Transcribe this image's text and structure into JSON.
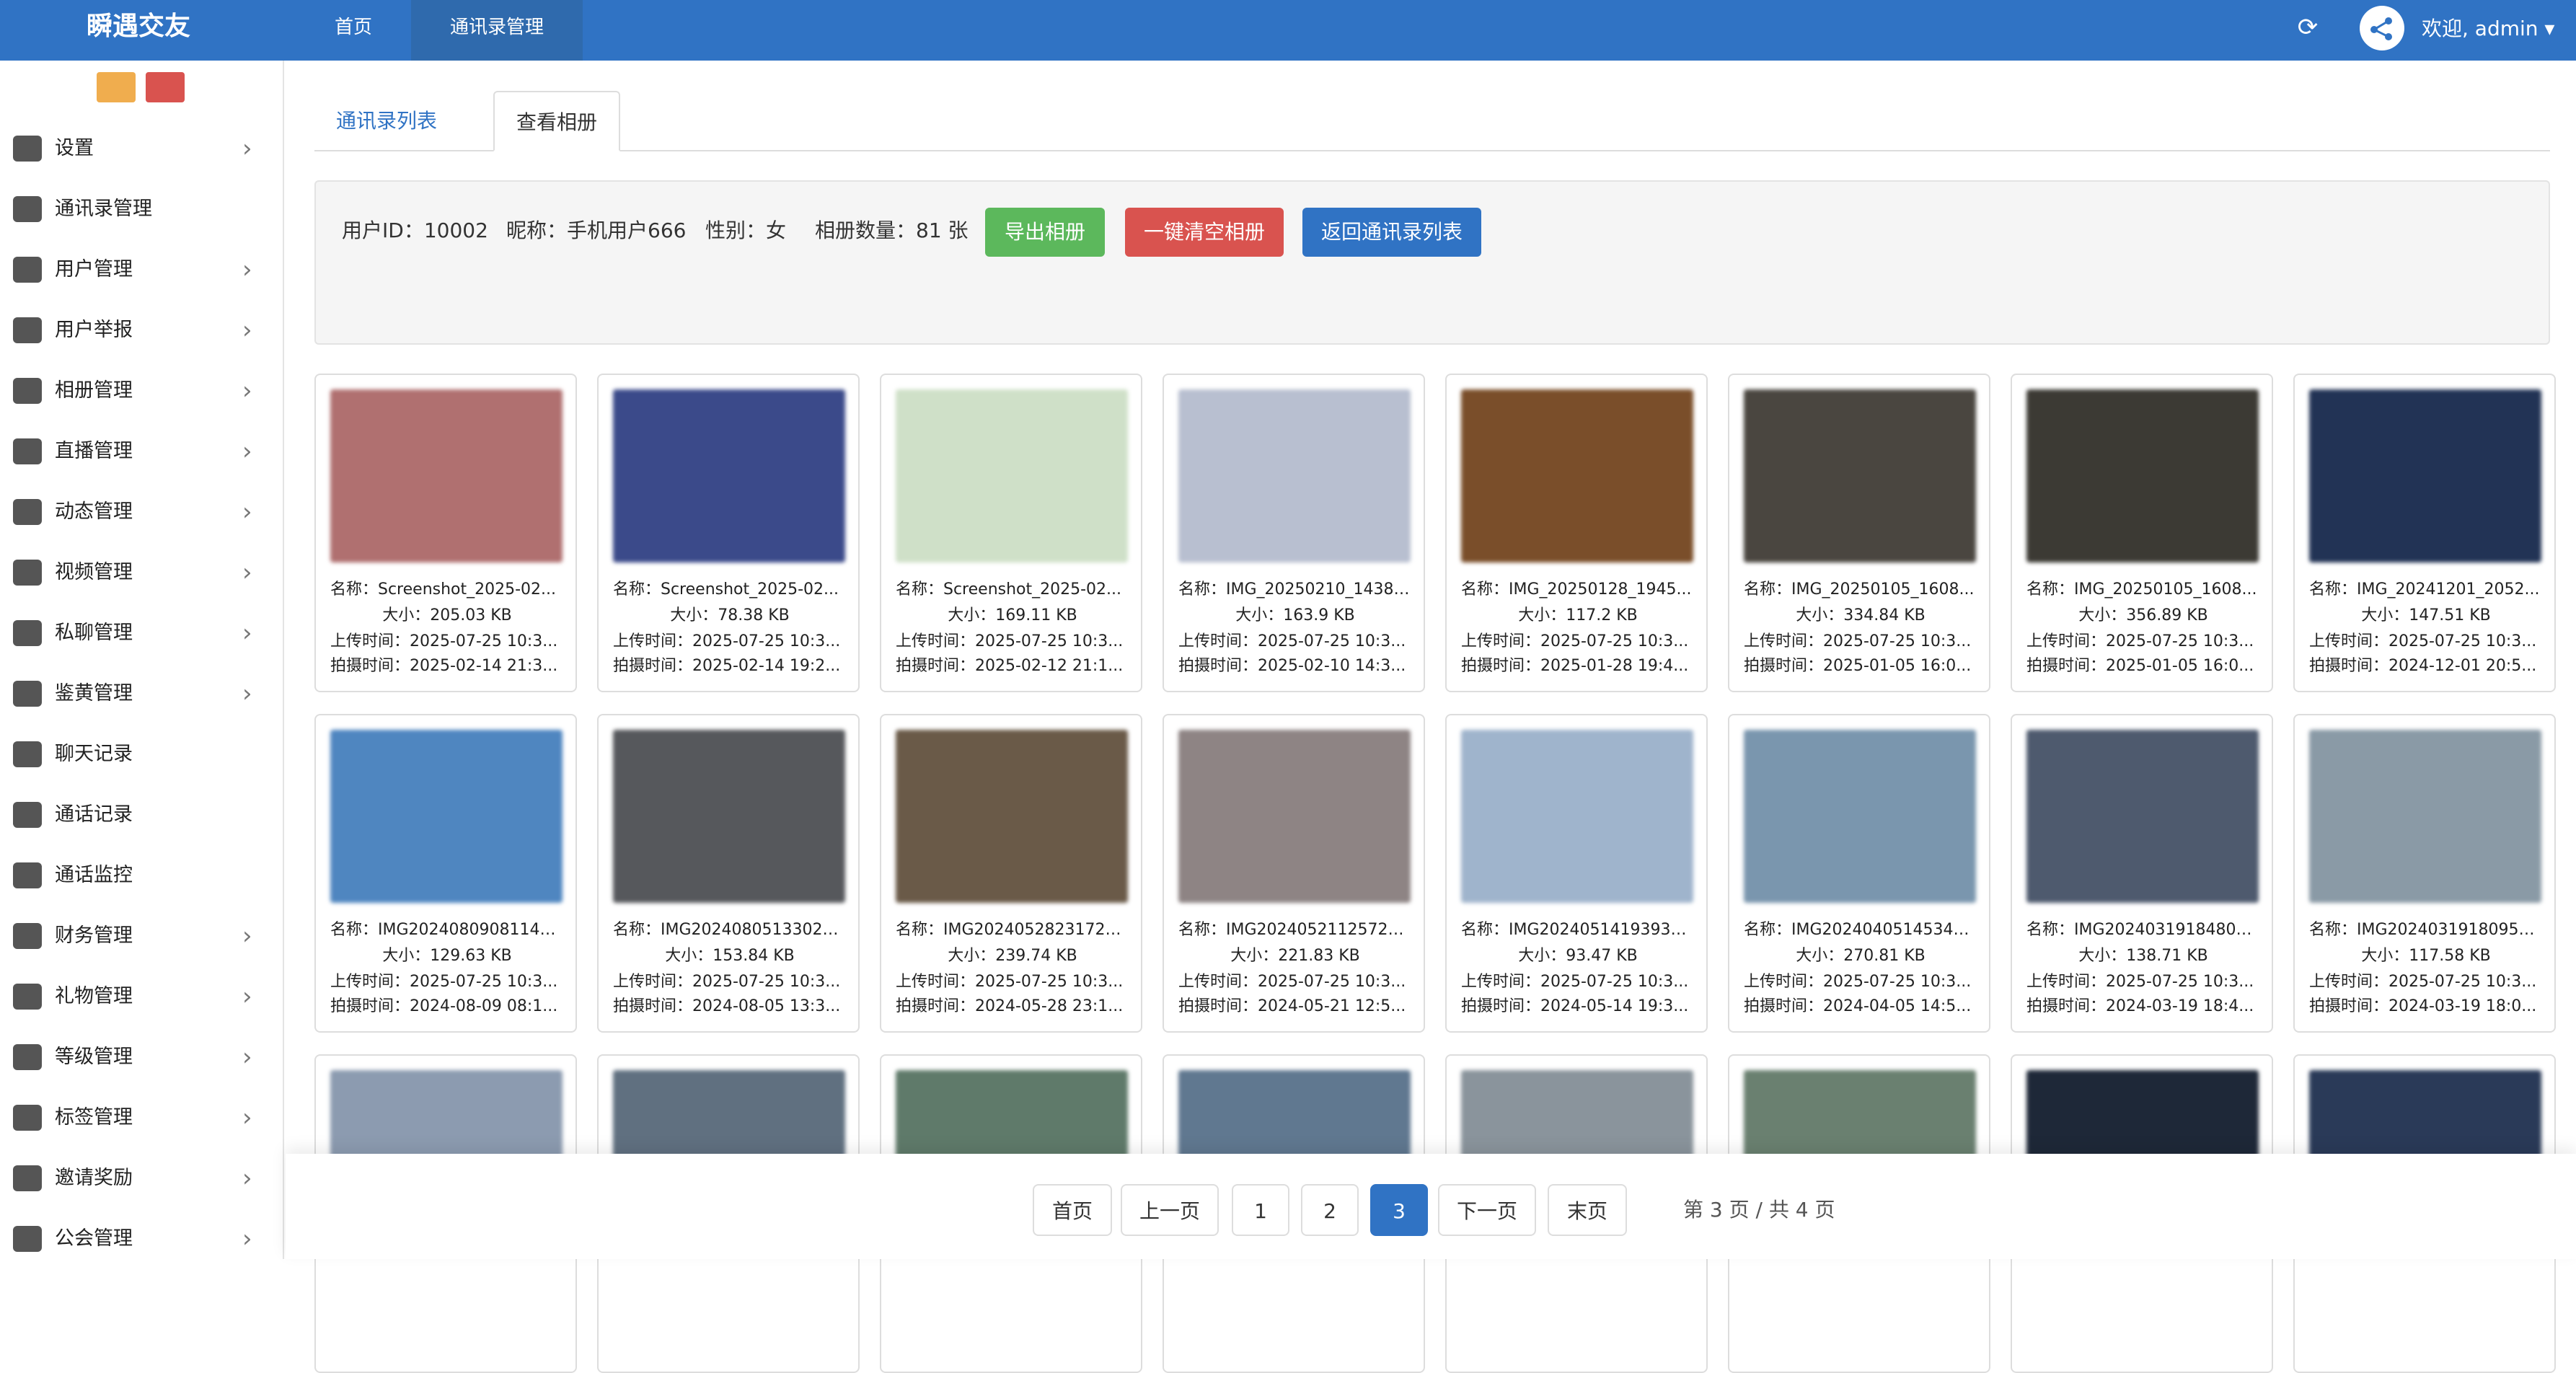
{
  "app": {
    "title": "瞬遇交友"
  },
  "topnav": [
    {
      "label": "首页"
    },
    {
      "label": "通讯录管理"
    }
  ],
  "user": {
    "welcome": "欢迎, admin ▾"
  },
  "sidebar": {
    "items": [
      {
        "label": "设置",
        "icon": "gear-icon",
        "chevron": true
      },
      {
        "label": "通讯录管理",
        "icon": "contacts-icon",
        "chevron": false
      },
      {
        "label": "用户管理",
        "icon": "users-icon",
        "chevron": true
      },
      {
        "label": "用户举报",
        "icon": "report-icon",
        "chevron": true
      },
      {
        "label": "相册管理",
        "icon": "image-icon",
        "chevron": true
      },
      {
        "label": "直播管理",
        "icon": "eye-icon",
        "chevron": true
      },
      {
        "label": "动态管理",
        "icon": "star-icon",
        "chevron": true
      },
      {
        "label": "视频管理",
        "icon": "video-icon",
        "chevron": true
      },
      {
        "label": "私聊管理",
        "icon": "send-icon",
        "chevron": true
      },
      {
        "label": "鉴黄管理",
        "icon": "monitor-icon",
        "chevron": true
      },
      {
        "label": "聊天记录",
        "icon": "chat-icon",
        "chevron": false
      },
      {
        "label": "通话记录",
        "icon": "monitor-icon",
        "chevron": false
      },
      {
        "label": "通话监控",
        "icon": "monitor-icon",
        "chevron": false
      },
      {
        "label": "财务管理",
        "icon": "yen-icon",
        "chevron": true
      },
      {
        "label": "礼物管理",
        "icon": "gift-icon",
        "chevron": true
      },
      {
        "label": "等级管理",
        "icon": "level-icon",
        "chevron": true
      },
      {
        "label": "标签管理",
        "icon": "bookmark-icon",
        "chevron": true
      },
      {
        "label": "邀请奖励",
        "icon": "sitemap-icon",
        "chevron": true
      },
      {
        "label": "公会管理",
        "icon": "monitor-icon",
        "chevron": true
      }
    ]
  },
  "tabs": [
    {
      "label": "通讯录列表"
    },
    {
      "label": "查看相册"
    }
  ],
  "info": {
    "user_id": "用户ID：10002",
    "nickname": "昵称：手机用户666",
    "gender": "性别：女",
    "count": "相册数量：81 张"
  },
  "actions": {
    "export": "导出相册",
    "clear": "一键清空相册",
    "back": "返回通讯录列表"
  },
  "photos": [
    {
      "name": "名称：Screenshot_2025-02...",
      "size": "大小：205.03 KB",
      "upload": "上传时间：2025-07-25 10:3...",
      "shot": "拍摄时间：2025-02-14 21:3...",
      "color": "#b07070"
    },
    {
      "name": "名称：Screenshot_2025-02...",
      "size": "大小：78.38 KB",
      "upload": "上传时间：2025-07-25 10:3...",
      "shot": "拍摄时间：2025-02-14 19:2...",
      "color": "#3b4a8a"
    },
    {
      "name": "名称：Screenshot_2025-02...",
      "size": "大小：169.11 KB",
      "upload": "上传时间：2025-07-25 10:3...",
      "shot": "拍摄时间：2025-02-12 21:1...",
      "color": "#cfe0c8"
    },
    {
      "name": "名称：IMG_20250210_14381...",
      "size": "大小：163.9 KB",
      "upload": "上传时间：2025-07-25 10:3...",
      "shot": "拍摄时间：2025-02-10 14:3...",
      "color": "#b8bfd0"
    },
    {
      "name": "名称：IMG_20250128_1945...",
      "size": "大小：117.2 KB",
      "upload": "上传时间：2025-07-25 10:3...",
      "shot": "拍摄时间：2025-01-28 19:4...",
      "color": "#7a4e2a"
    },
    {
      "name": "名称：IMG_20250105_1608...",
      "size": "大小：334.84 KB",
      "upload": "上传时间：2025-07-25 10:3...",
      "shot": "拍摄时间：2025-01-05 16:0...",
      "color": "#4a4640"
    },
    {
      "name": "名称：IMG_20250105_1608...",
      "size": "大小：356.89 KB",
      "upload": "上传时间：2025-07-25 10:3...",
      "shot": "拍摄时间：2025-01-05 16:0...",
      "color": "#3c3a34"
    },
    {
      "name": "名称：IMG_20241201_2052...",
      "size": "大小：147.51 KB",
      "upload": "上传时间：2025-07-25 10:3...",
      "shot": "拍摄时间：2024-12-01 20:5...",
      "color": "#223355"
    },
    {
      "name": "名称：IMG20240809081145...",
      "size": "大小：129.63 KB",
      "upload": "上传时间：2025-07-25 10:3...",
      "shot": "拍摄时间：2024-08-09 08:1...",
      "color": "#4f86c0"
    },
    {
      "name": "名称：IMG20240805133027...",
      "size": "大小：153.84 KB",
      "upload": "上传时间：2025-07-25 10:3...",
      "shot": "拍摄时间：2024-08-05 13:3...",
      "color": "#56585c"
    },
    {
      "name": "名称：IMG20240528231726...",
      "size": "大小：239.74 KB",
      "upload": "上传时间：2025-07-25 10:3...",
      "shot": "拍摄时间：2024-05-28 23:1...",
      "color": "#6a5a48"
    },
    {
      "name": "名称：IMG20240521125726...",
      "size": "大小：221.83 KB",
      "upload": "上传时间：2025-07-25 10:3...",
      "shot": "拍摄时间：2024-05-21 12:5...",
      "color": "#8e8484"
    },
    {
      "name": "名称：IMG20240514193937...",
      "size": "大小：93.47 KB",
      "upload": "上传时间：2025-07-25 10:3...",
      "shot": "拍摄时间：2024-05-14 19:3...",
      "color": "#9fb4cc"
    },
    {
      "name": "名称：IMG20240405145345...",
      "size": "大小：270.81 KB",
      "upload": "上传时间：2025-07-25 10:3...",
      "shot": "拍摄时间：2024-04-05 14:5...",
      "color": "#7a96ae"
    },
    {
      "name": "名称：IMG20240319184807...",
      "size": "大小：138.71 KB",
      "upload": "上传时间：2025-07-25 10:3...",
      "shot": "拍摄时间：2024-03-19 18:4...",
      "color": "#4e5a6e"
    },
    {
      "name": "名称：IMG20240319180955...",
      "size": "大小：117.58 KB",
      "upload": "上传时间：2025-07-25 10:3...",
      "shot": "拍摄时间：2024-03-19 18:0...",
      "color": "#8a9aa6"
    },
    {
      "name": "",
      "size": "",
      "upload": "",
      "shot": "",
      "color": "#8c9bb0"
    },
    {
      "name": "",
      "size": "",
      "upload": "",
      "shot": "",
      "color": "#607080"
    },
    {
      "name": "",
      "size": "",
      "upload": "",
      "shot": "",
      "color": "#5f7a6a"
    },
    {
      "name": "",
      "size": "",
      "upload": "",
      "shot": "",
      "color": "#607890"
    },
    {
      "name": "",
      "size": "",
      "upload": "",
      "shot": "",
      "color": "#8a949c"
    },
    {
      "name": "",
      "size": "",
      "upload": "",
      "shot": "",
      "color": "#6a8070"
    },
    {
      "name": "",
      "size": "",
      "upload": "",
      "shot": "",
      "color": "#1e2838"
    },
    {
      "name": "",
      "size": "",
      "upload": "",
      "shot": "",
      "color": "#2a3a58"
    }
  ],
  "pagination": {
    "first": "首页",
    "prev": "上一页",
    "p1": "1",
    "p2": "2",
    "p3": "3",
    "next": "下一页",
    "last": "末页",
    "info": "第 3 页 / 共 4 页",
    "current": 3
  },
  "colors": {
    "primary": "#3073c4",
    "success": "#5cb85c",
    "danger": "#d9534f",
    "warning": "#f0ad4e"
  }
}
